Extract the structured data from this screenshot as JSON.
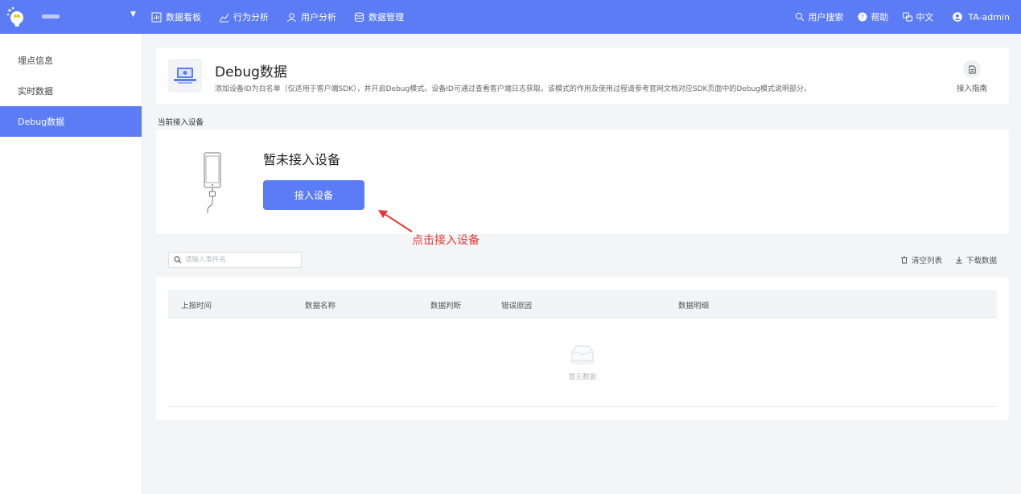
{
  "topbar": {
    "nav": [
      {
        "label": "数据看板",
        "icon": "dashboard-icon"
      },
      {
        "label": "行为分析",
        "icon": "trend-chart-icon"
      },
      {
        "label": "用户分析",
        "icon": "user-icon"
      },
      {
        "label": "数据管理",
        "icon": "database-icon"
      }
    ],
    "search_user": "用户搜索",
    "help": "帮助",
    "language": "中文",
    "username": "TA-admin"
  },
  "sidebar": {
    "items": [
      {
        "label": "埋点信息"
      },
      {
        "label": "实时数据"
      },
      {
        "label": "Debug数据"
      }
    ]
  },
  "header": {
    "title": "Debug数据",
    "description": "添加设备ID为白名单（仅适用于客户端SDK），并开启Debug模式。设备ID可通过查看客户端日志获取。该模式的作用及使用过程请参考官网文档对应SDK页面中的Debug模式说明部分。",
    "guide_label": "接入指南"
  },
  "device": {
    "section_label": "当前接入设备",
    "title": "暂未接入设备",
    "button_label": "接入设备"
  },
  "annotation": {
    "text": "点击接入设备"
  },
  "search": {
    "placeholder": "请输入事件名"
  },
  "toolbar": {
    "clear": "清空列表",
    "download": "下载数据"
  },
  "table": {
    "columns": [
      "上报时间",
      "数据名称",
      "数据判断",
      "错误原因",
      "数据明细"
    ],
    "empty_text": "暂无数据"
  },
  "colors": {
    "accent": "#5b7cf5",
    "annotation": "#e53935"
  }
}
